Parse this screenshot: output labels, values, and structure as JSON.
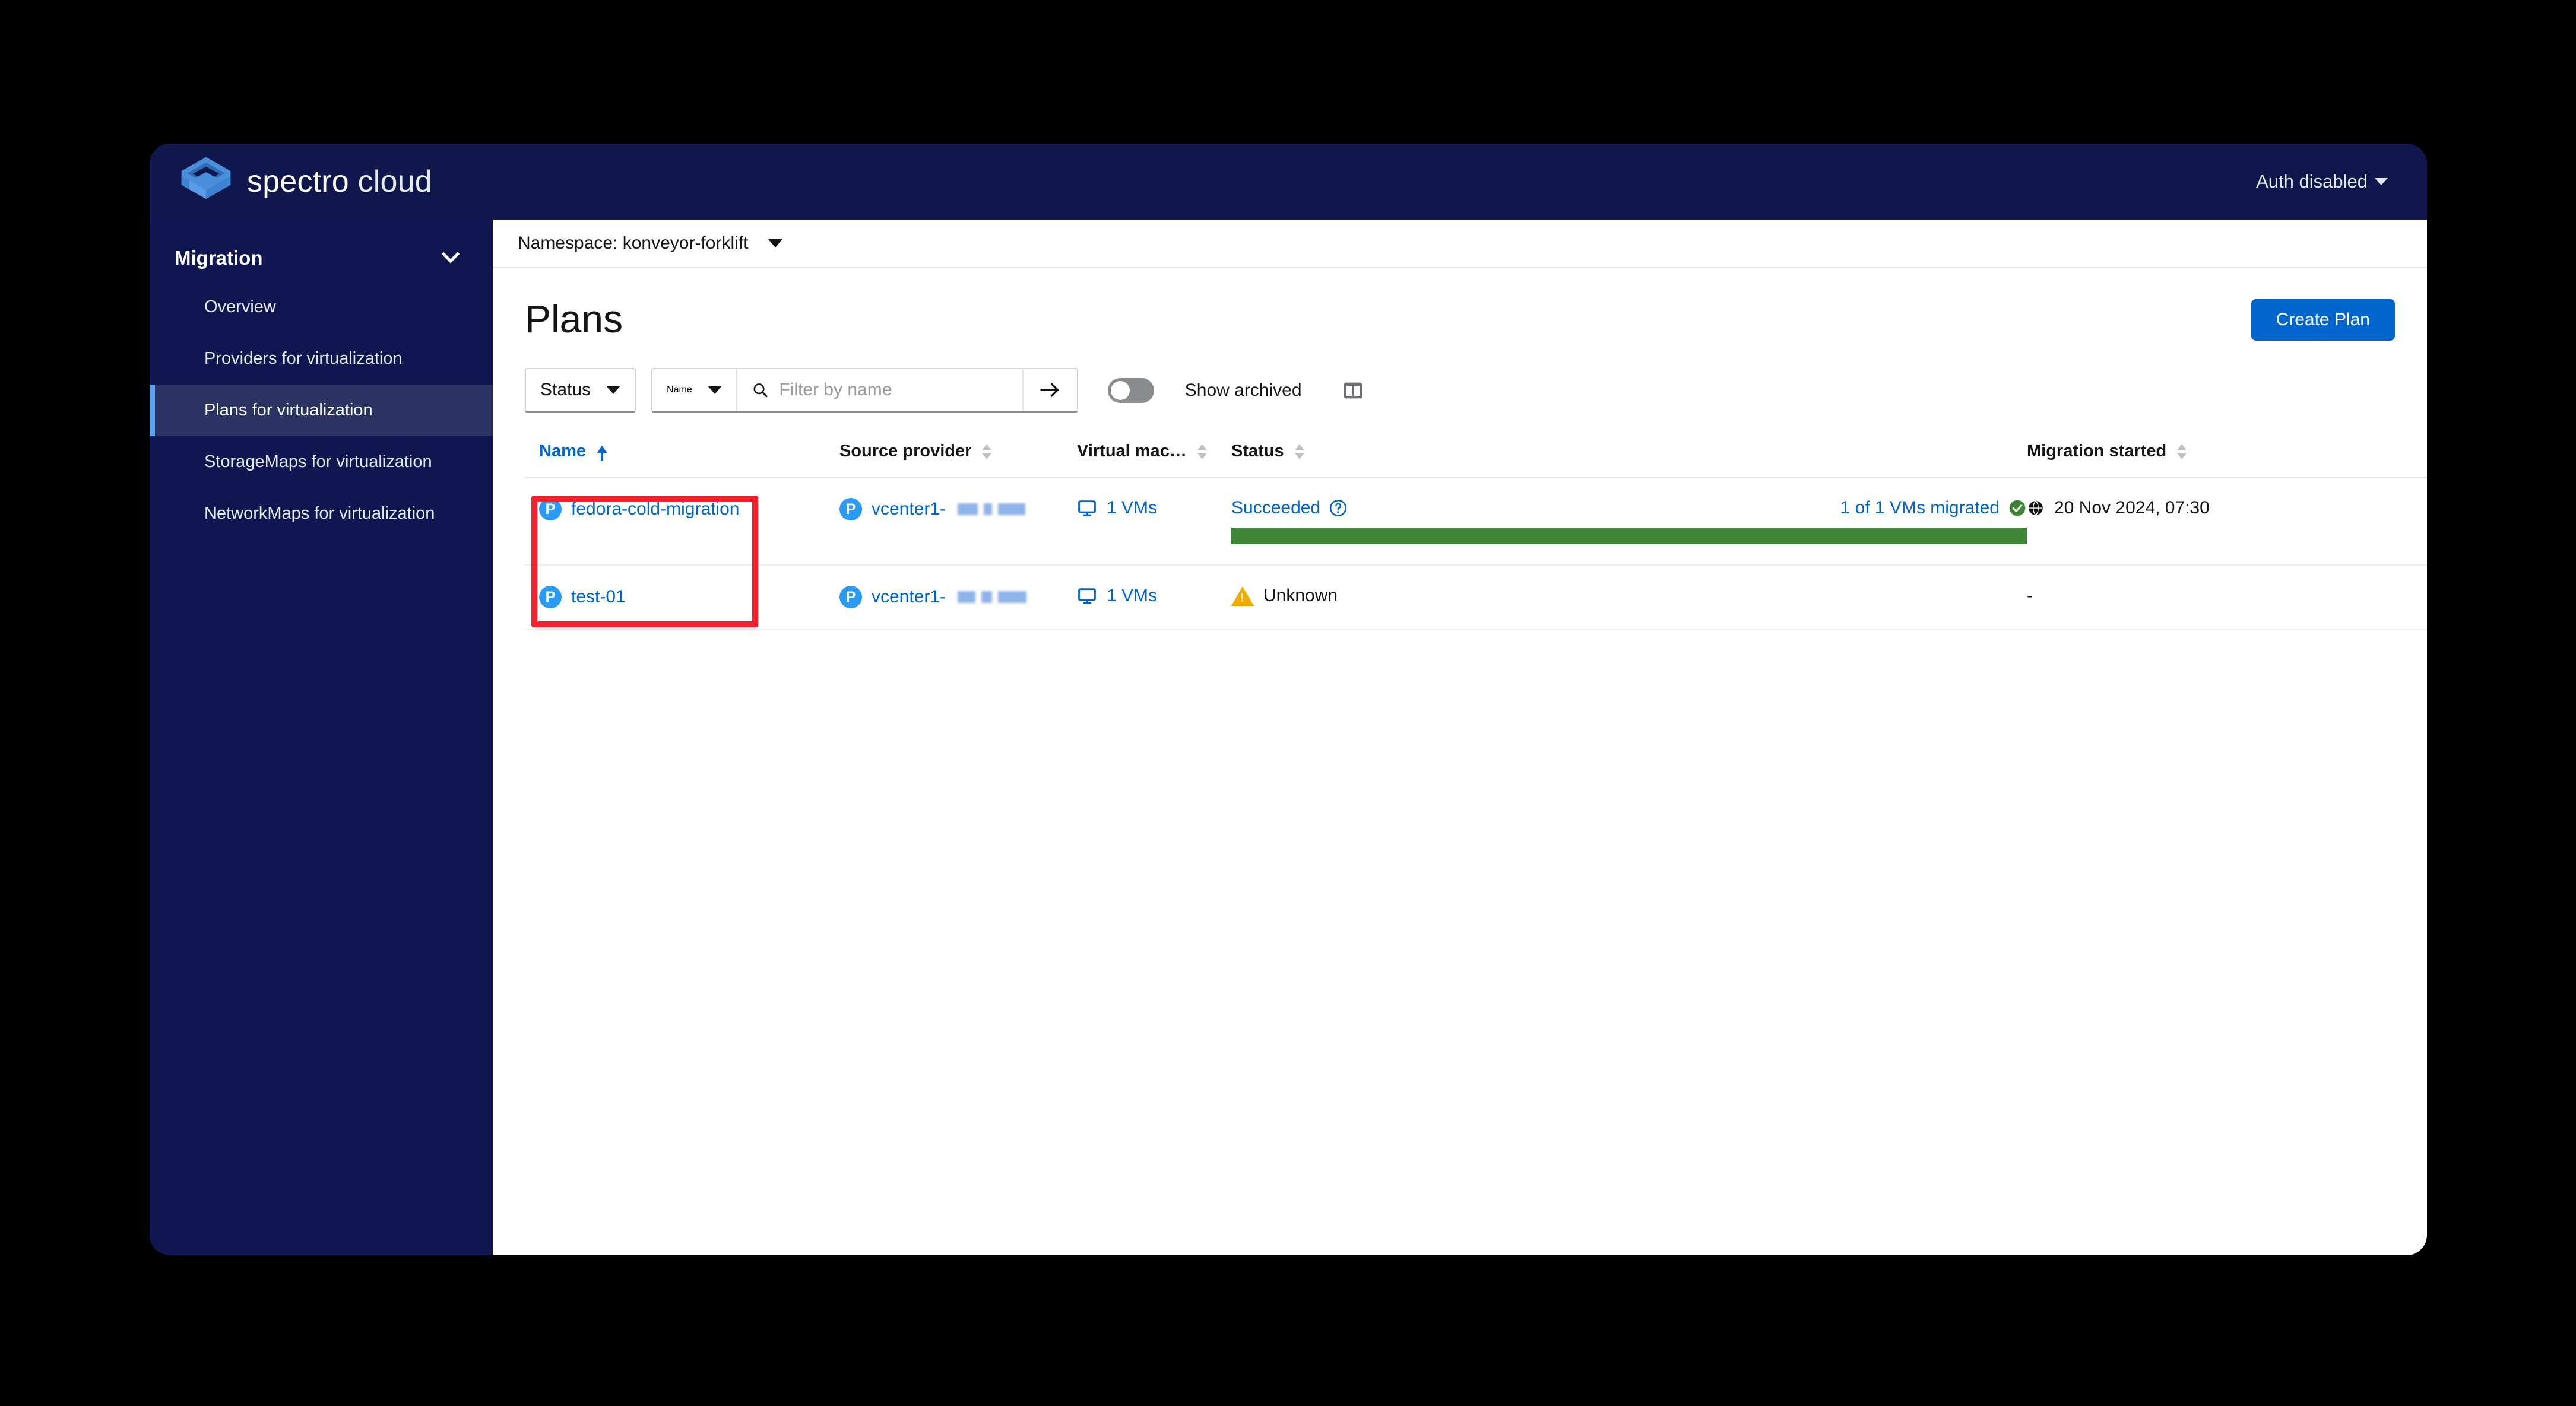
{
  "brand": {
    "name_bold": "spectro",
    "name_light": "cloud",
    "logo_icon": "spectro-logo-icon"
  },
  "masthead": {
    "auth_label": "Auth disabled",
    "caret_icon": "caret-down-icon"
  },
  "sidebar": {
    "group_label": "Migration",
    "group_chevron_icon": "chevron-down-icon",
    "items": [
      {
        "label": "Overview",
        "active": false
      },
      {
        "label": "Providers for virtualization",
        "active": false
      },
      {
        "label": "Plans for virtualization",
        "active": true
      },
      {
        "label": "StorageMaps for virtualization",
        "active": false
      },
      {
        "label": "NetworkMaps for virtualization",
        "active": false
      }
    ]
  },
  "namespace_bar": {
    "label": "Namespace: konveyor-forklift",
    "caret_icon": "caret-down-icon"
  },
  "page": {
    "title": "Plans",
    "create_button": "Create Plan"
  },
  "toolbar": {
    "status_select": "Status",
    "name_select": "Name",
    "search_placeholder": "Filter by name",
    "search_value": "",
    "search_icon": "search-icon",
    "submit_icon": "arrow-right-icon",
    "show_archived_label": "Show archived",
    "show_archived_on": false,
    "columns_icon": "columns-icon"
  },
  "table": {
    "columns": [
      {
        "key": "name",
        "label": "Name",
        "sort": "asc"
      },
      {
        "key": "source",
        "label": "Source provider",
        "sort": "none"
      },
      {
        "key": "vms",
        "label": "Virtual mac…",
        "sort": "none"
      },
      {
        "key": "status",
        "label": "Status",
        "sort": "none"
      },
      {
        "key": "migration",
        "label": "Migration started",
        "sort": "none"
      },
      {
        "key": "actions",
        "label": "",
        "sort": null
      }
    ],
    "rows": [
      {
        "name": "fedora-cold-migration",
        "name_badge": "P",
        "source": "vcenter1-",
        "source_badge": "P",
        "source_redacted": true,
        "vms": "1 VMs",
        "vms_icon": "virtual-machine-icon",
        "status": "Succeeded",
        "status_help_icon": "help-circle-icon",
        "progress_label": "1 of 1 VMs migrated",
        "progress_icon": "check-circle-icon",
        "progress_percent": 100,
        "migration_started": "20 Nov 2024, 07:30",
        "migration_icon": "globe-icon",
        "kebab_icon": "kebab-menu-icon"
      },
      {
        "name": "test-01",
        "name_badge": "P",
        "source": "vcenter1-",
        "source_badge": "P",
        "source_redacted": true,
        "vms": "1 VMs",
        "vms_icon": "virtual-machine-icon",
        "status": "Unknown",
        "status_warn_icon": "warning-triangle-icon",
        "progress_label": null,
        "progress_percent": null,
        "migration_started": "-",
        "migration_icon": null,
        "kebab_icon": "kebab-menu-icon"
      }
    ]
  },
  "annotation": {
    "shape": "rectangle",
    "color": "#f5222d",
    "target": "name-column-cells"
  }
}
